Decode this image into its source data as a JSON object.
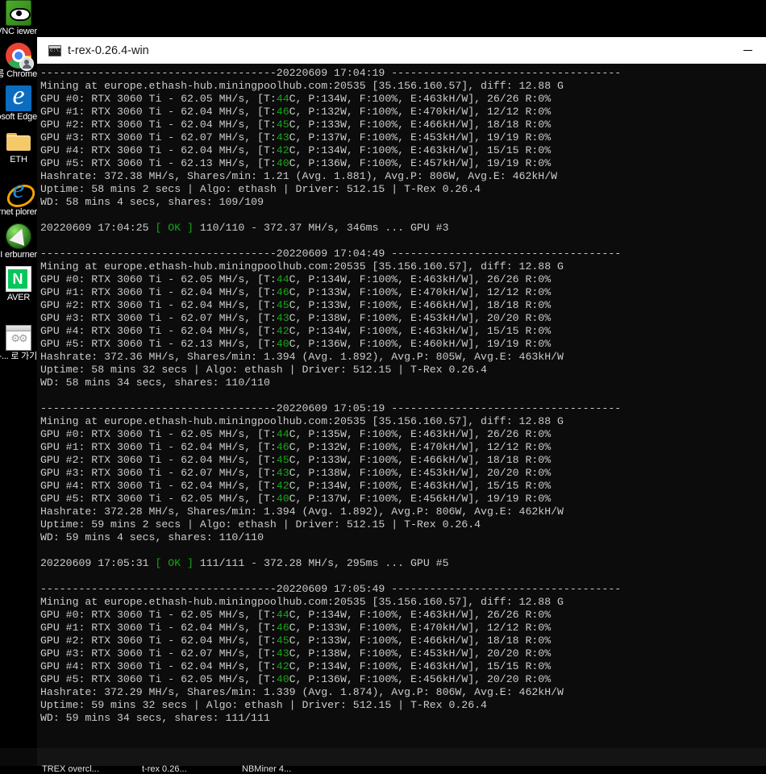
{
  "desktop": {
    "icons": [
      {
        "name": "ultravnc-viewer",
        "label": "raVNC\niewer",
        "icon": "eye-icon"
      },
      {
        "name": "chrome-user",
        "label": "자 이름\nChrome",
        "icon": "chrome-icon"
      },
      {
        "name": "microsoft-edge",
        "label": "crosoft\nEdge",
        "icon": "edge-icon"
      },
      {
        "name": "eth-folder",
        "label": "ETH",
        "icon": "folder-icon"
      },
      {
        "name": "internet-explorer",
        "label": "ternet\nplorer",
        "icon": "internet-explorer-icon"
      },
      {
        "name": "msi-afterburner",
        "label": "MSI\nerburner",
        "icon": "msi-afterburner-icon"
      },
      {
        "name": "naver",
        "label": "AVER",
        "icon": "naver-icon"
      },
      {
        "name": "overclock-shortcut",
        "label": "rclock-...\n로 가기",
        "icon": "settings-window-icon"
      }
    ]
  },
  "window": {
    "title": "t-rex-0.26.4-win",
    "icon": "console-icon",
    "minimize_label": "Minimize"
  },
  "taskbar": {
    "buttons": [
      {
        "name": "taskbar-trex-overclock",
        "label": "TREX overcl..."
      },
      {
        "name": "taskbar-t-rex",
        "label": "t-rex 0.26..."
      },
      {
        "name": "taskbar-nbminer",
        "label": "NBMiner 4..."
      }
    ]
  },
  "console": {
    "miner": "T-Rex 0.26.4",
    "pool": "europe.ethash-hub.miningpoolhub.com:20535",
    "pool_ip": "35.156.160.57",
    "diff": "12.88 G",
    "algo": "ethash",
    "driver": "512.15",
    "gpu_model": "RTX 3060 Ti",
    "separator_char": "-",
    "blocks": [
      {
        "timestamp": "20220609 17:04:19",
        "header": "Mining at europe.ethash-hub.miningpoolhub.com:20535 [35.156.160.57], diff: 12.88 G",
        "gpus": [
          {
            "id": "GPU #0",
            "model": "RTX 3060 Ti",
            "hashrate": "62.05 MH/s",
            "temp": "44",
            "power": "134W",
            "fan": "100%",
            "eff": "463kH/W",
            "shares": "26/26",
            "reject": "R:0%"
          },
          {
            "id": "GPU #1",
            "model": "RTX 3060 Ti",
            "hashrate": "62.04 MH/s",
            "temp": "46",
            "power": "132W",
            "fan": "100%",
            "eff": "470kH/W",
            "shares": "12/12",
            "reject": "R:0%"
          },
          {
            "id": "GPU #2",
            "model": "RTX 3060 Ti",
            "hashrate": "62.04 MH/s",
            "temp": "45",
            "power": "133W",
            "fan": "100%",
            "eff": "466kH/W",
            "shares": "18/18",
            "reject": "R:0%"
          },
          {
            "id": "GPU #3",
            "model": "RTX 3060 Ti",
            "hashrate": "62.07 MH/s",
            "temp": "43",
            "power": "137W",
            "fan": "100%",
            "eff": "453kH/W",
            "shares": "19/19",
            "reject": "R:0%"
          },
          {
            "id": "GPU #4",
            "model": "RTX 3060 Ti",
            "hashrate": "62.04 MH/s",
            "temp": "42",
            "power": "134W",
            "fan": "100%",
            "eff": "463kH/W",
            "shares": "15/15",
            "reject": "R:0%"
          },
          {
            "id": "GPU #5",
            "model": "RTX 3060 Ti",
            "hashrate": "62.13 MH/s",
            "temp": "40",
            "power": "136W",
            "fan": "100%",
            "eff": "457kH/W",
            "shares": "19/19",
            "reject": "R:0%"
          }
        ],
        "hashrate_line": "Hashrate: 372.38 MH/s, Shares/min: 1.21 (Avg. 1.881), Avg.P: 806W, Avg.E: 462kH/W",
        "uptime_line": "Uptime: 58 mins 2 secs | Algo: ethash | Driver: 512.15 | T-Rex 0.26.4",
        "wd_line": "WD: 58 mins 4 secs, shares: 109/109",
        "share_line": {
          "time": "20220609 17:04:25",
          "status": "[ OK ]",
          "detail": "110/110 - 372.37 MH/s, 346ms ... GPU #3"
        }
      },
      {
        "timestamp": "20220609 17:04:49",
        "header": "Mining at europe.ethash-hub.miningpoolhub.com:20535 [35.156.160.57], diff: 12.88 G",
        "gpus": [
          {
            "id": "GPU #0",
            "model": "RTX 3060 Ti",
            "hashrate": "62.05 MH/s",
            "temp": "44",
            "power": "134W",
            "fan": "100%",
            "eff": "463kH/W",
            "shares": "26/26",
            "reject": "R:0%"
          },
          {
            "id": "GPU #1",
            "model": "RTX 3060 Ti",
            "hashrate": "62.04 MH/s",
            "temp": "46",
            "power": "133W",
            "fan": "100%",
            "eff": "470kH/W",
            "shares": "12/12",
            "reject": "R:0%"
          },
          {
            "id": "GPU #2",
            "model": "RTX 3060 Ti",
            "hashrate": "62.04 MH/s",
            "temp": "45",
            "power": "133W",
            "fan": "100%",
            "eff": "466kH/W",
            "shares": "18/18",
            "reject": "R:0%"
          },
          {
            "id": "GPU #3",
            "model": "RTX 3060 Ti",
            "hashrate": "62.07 MH/s",
            "temp": "43",
            "power": "138W",
            "fan": "100%",
            "eff": "453kH/W",
            "shares": "20/20",
            "reject": "R:0%"
          },
          {
            "id": "GPU #4",
            "model": "RTX 3060 Ti",
            "hashrate": "62.04 MH/s",
            "temp": "42",
            "power": "134W",
            "fan": "100%",
            "eff": "463kH/W",
            "shares": "15/15",
            "reject": "R:0%"
          },
          {
            "id": "GPU #5",
            "model": "RTX 3060 Ti",
            "hashrate": "62.13 MH/s",
            "temp": "40",
            "power": "136W",
            "fan": "100%",
            "eff": "460kH/W",
            "shares": "19/19",
            "reject": "R:0%"
          }
        ],
        "hashrate_line": "Hashrate: 372.36 MH/s, Shares/min: 1.394 (Avg. 1.892), Avg.P: 805W, Avg.E: 463kH/W",
        "uptime_line": "Uptime: 58 mins 32 secs | Algo: ethash | Driver: 512.15 | T-Rex 0.26.4",
        "wd_line": "WD: 58 mins 34 secs, shares: 110/110",
        "share_line": null
      },
      {
        "timestamp": "20220609 17:05:19",
        "header": "Mining at europe.ethash-hub.miningpoolhub.com:20535 [35.156.160.57], diff: 12.88 G",
        "gpus": [
          {
            "id": "GPU #0",
            "model": "RTX 3060 Ti",
            "hashrate": "62.05 MH/s",
            "temp": "44",
            "power": "135W",
            "fan": "100%",
            "eff": "463kH/W",
            "shares": "26/26",
            "reject": "R:0%"
          },
          {
            "id": "GPU #1",
            "model": "RTX 3060 Ti",
            "hashrate": "62.04 MH/s",
            "temp": "46",
            "power": "132W",
            "fan": "100%",
            "eff": "470kH/W",
            "shares": "12/12",
            "reject": "R:0%"
          },
          {
            "id": "GPU #2",
            "model": "RTX 3060 Ti",
            "hashrate": "62.04 MH/s",
            "temp": "45",
            "power": "133W",
            "fan": "100%",
            "eff": "466kH/W",
            "shares": "18/18",
            "reject": "R:0%"
          },
          {
            "id": "GPU #3",
            "model": "RTX 3060 Ti",
            "hashrate": "62.07 MH/s",
            "temp": "43",
            "power": "138W",
            "fan": "100%",
            "eff": "453kH/W",
            "shares": "20/20",
            "reject": "R:0%"
          },
          {
            "id": "GPU #4",
            "model": "RTX 3060 Ti",
            "hashrate": "62.04 MH/s",
            "temp": "42",
            "power": "134W",
            "fan": "100%",
            "eff": "463kH/W",
            "shares": "15/15",
            "reject": "R:0%"
          },
          {
            "id": "GPU #5",
            "model": "RTX 3060 Ti",
            "hashrate": "62.05 MH/s",
            "temp": "40",
            "power": "137W",
            "fan": "100%",
            "eff": "456kH/W",
            "shares": "19/19",
            "reject": "R:0%"
          }
        ],
        "hashrate_line": "Hashrate: 372.28 MH/s, Shares/min: 1.394 (Avg. 1.892), Avg.P: 806W, Avg.E: 462kH/W",
        "uptime_line": "Uptime: 59 mins 2 secs | Algo: ethash | Driver: 512.15 | T-Rex 0.26.4",
        "wd_line": "WD: 59 mins 4 secs, shares: 110/110",
        "share_line": {
          "time": "20220609 17:05:31",
          "status": "[ OK ]",
          "detail": "111/111 - 372.28 MH/s, 295ms ... GPU #5"
        }
      },
      {
        "timestamp": "20220609 17:05:49",
        "header": "Mining at europe.ethash-hub.miningpoolhub.com:20535 [35.156.160.57], diff: 12.88 G",
        "gpus": [
          {
            "id": "GPU #0",
            "model": "RTX 3060 Ti",
            "hashrate": "62.05 MH/s",
            "temp": "44",
            "power": "134W",
            "fan": "100%",
            "eff": "463kH/W",
            "shares": "26/26",
            "reject": "R:0%"
          },
          {
            "id": "GPU #1",
            "model": "RTX 3060 Ti",
            "hashrate": "62.04 MH/s",
            "temp": "46",
            "power": "133W",
            "fan": "100%",
            "eff": "470kH/W",
            "shares": "12/12",
            "reject": "R:0%"
          },
          {
            "id": "GPU #2",
            "model": "RTX 3060 Ti",
            "hashrate": "62.04 MH/s",
            "temp": "45",
            "power": "133W",
            "fan": "100%",
            "eff": "466kH/W",
            "shares": "18/18",
            "reject": "R:0%"
          },
          {
            "id": "GPU #3",
            "model": "RTX 3060 Ti",
            "hashrate": "62.07 MH/s",
            "temp": "43",
            "power": "138W",
            "fan": "100%",
            "eff": "453kH/W",
            "shares": "20/20",
            "reject": "R:0%"
          },
          {
            "id": "GPU #4",
            "model": "RTX 3060 Ti",
            "hashrate": "62.04 MH/s",
            "temp": "42",
            "power": "134W",
            "fan": "100%",
            "eff": "463kH/W",
            "shares": "15/15",
            "reject": "R:0%"
          },
          {
            "id": "GPU #5",
            "model": "RTX 3060 Ti",
            "hashrate": "62.05 MH/s",
            "temp": "40",
            "power": "136W",
            "fan": "100%",
            "eff": "456kH/W",
            "shares": "20/20",
            "reject": "R:0%"
          }
        ],
        "hashrate_line": "Hashrate: 372.29 MH/s, Shares/min: 1.339 (Avg. 1.874), Avg.P: 806W, Avg.E: 462kH/W",
        "uptime_line": "Uptime: 59 mins 32 secs | Algo: ethash | Driver: 512.15 | T-Rex 0.26.4",
        "wd_line": "WD: 59 mins 34 secs, shares: 111/111",
        "share_line": null
      }
    ]
  },
  "colors": {
    "console_bg": "#0c0c0c",
    "console_fg": "#cccccc",
    "green": "#14a814",
    "titlebar_bg": "#ffffff"
  }
}
